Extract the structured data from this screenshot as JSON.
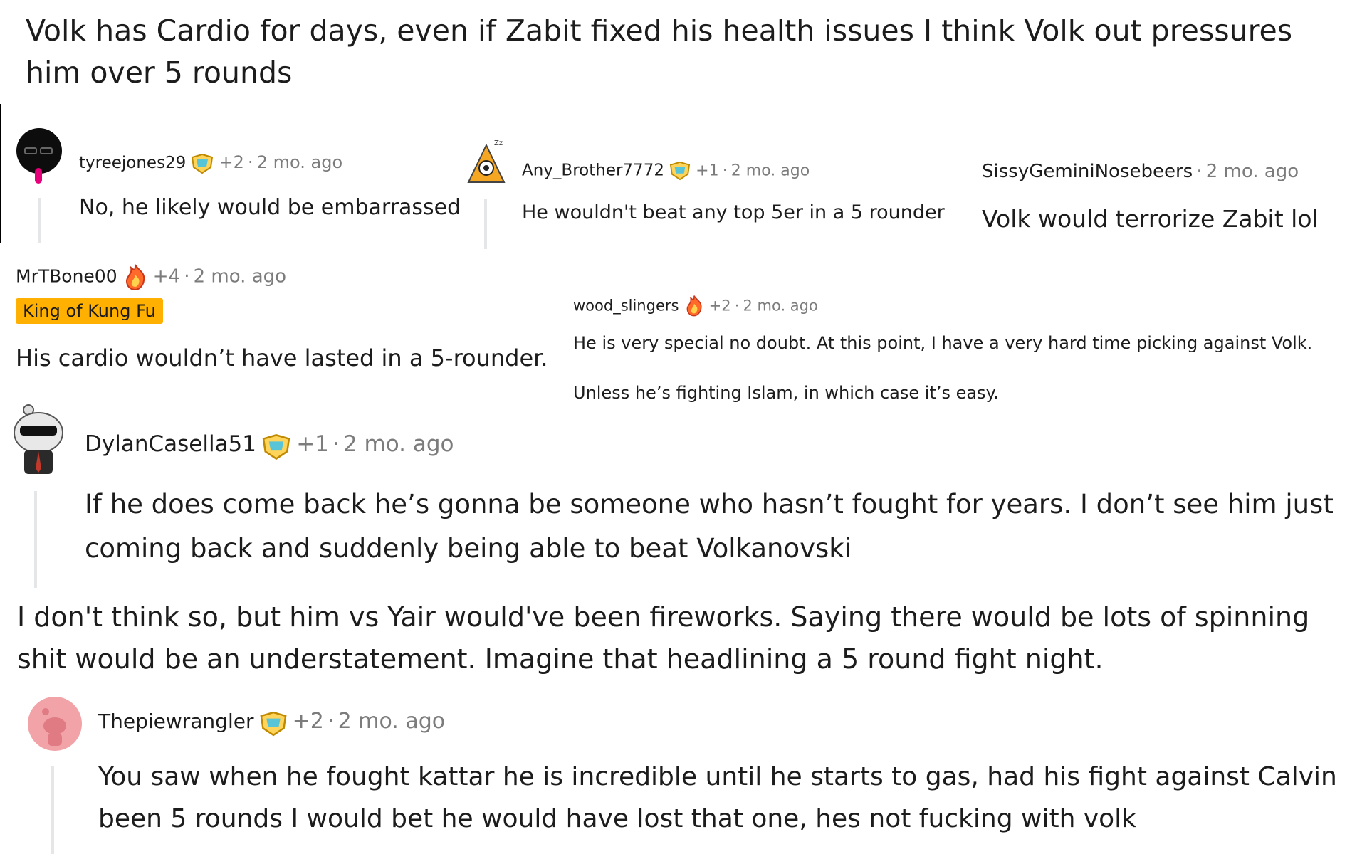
{
  "top_comment": {
    "text": "Volk has Cardio for days, even if Zabit fixed his health issues I think Volk out pressures him over 5 rounds"
  },
  "comments": [
    {
      "user": "tyreejones29",
      "score": "+2",
      "sep": "·",
      "time": "2 mo. ago",
      "text": "No, he likely would be embarrassed",
      "badge_icon": "shield-badge-icon"
    },
    {
      "user": "Any_Brother7772",
      "score": "+1",
      "sep": "·",
      "time": "2 mo. ago",
      "text": "He wouldn't beat any top 5er in a 5 rounder",
      "badge_icon": "shield-badge-icon"
    },
    {
      "user": "SissyGeminiNosebeers",
      "sep": "·",
      "time": "2 mo. ago",
      "text": "Volk would terrorize Zabit lol"
    },
    {
      "user": "MrTBone00",
      "score": "+4",
      "sep": "·",
      "time": "2 mo. ago",
      "flair": "King of Kung Fu",
      "text": "His cardio wouldn’t have lasted in a 5-rounder.",
      "badge_icon": "fire-badge-icon"
    },
    {
      "user": "wood_slingers",
      "score": "+2",
      "sep": "·",
      "time": "2 mo. ago",
      "text1": "He is very special no doubt. At this point, I have a very hard time picking against Volk.",
      "text2": "Unless he’s fighting Islam, in which case it’s easy.",
      "badge_icon": "fire-badge-icon"
    },
    {
      "user": "DylanCasella51",
      "score": "+1",
      "sep": "·",
      "time": "2 mo. ago",
      "line1": "If he does come back he’s gonna be someone who hasn’t fought for years. I don’t see him just",
      "line2": "coming back and suddenly being able to beat Volkanovski",
      "badge_icon": "shield-badge-icon"
    },
    {
      "line1": "I don't think so, but him vs Yair would've been fireworks. Saying there would be lots of spinning",
      "line2": "shit would be an understatement. Imagine that headlining a 5 round fight night."
    },
    {
      "user": "Thepiewrangler",
      "score": "+2",
      "sep": "·",
      "time": "2 mo. ago",
      "line1": "You saw when he fought kattar he is incredible until he starts to gas, had his fight against Calvin",
      "line2": "been 5 rounds I would bet he would have lost that one, hes not fucking with volk",
      "badge_icon": "shield-badge-icon"
    }
  ],
  "colors": {
    "flair_bg": "#ffb000",
    "meta": "#7c7c7c",
    "thread_line": "#e4e6e8",
    "avatar_pink": "#f2a3a8"
  }
}
